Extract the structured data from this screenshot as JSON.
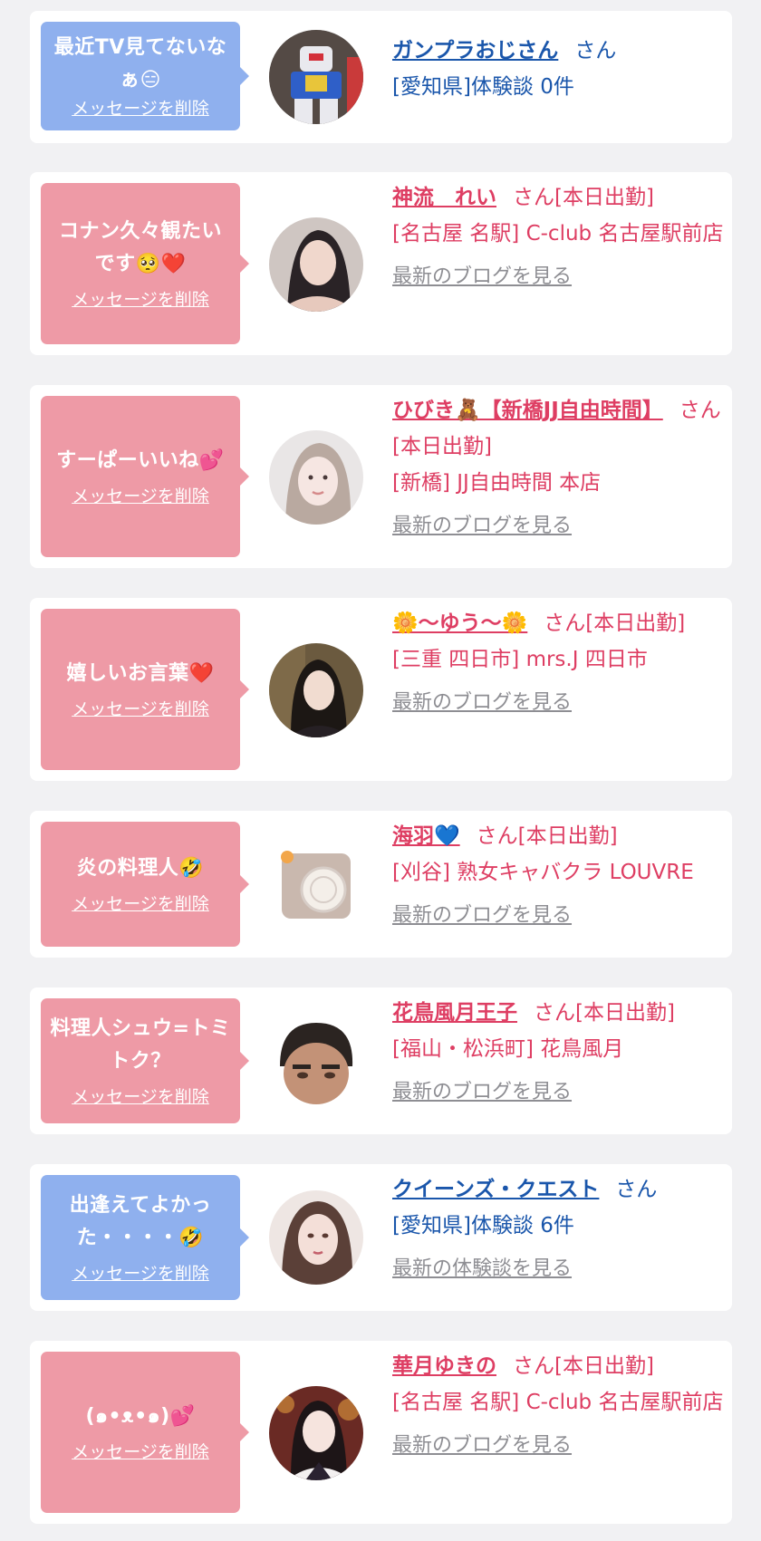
{
  "colors": {
    "pink_bubble": "#ee9aa6",
    "blue_bubble": "#8fb0ee",
    "shop_text": "#de3e63",
    "member_text": "#1a56ab",
    "link_gray": "#8e8e93"
  },
  "items": [
    {
      "bubble_color": "blue",
      "message": "最近TV見てないなぁ😑",
      "delete_label": "メッセージを削除",
      "name": "ガンプラおじさん",
      "suffix": "さん",
      "detail": "[愛知県]体験談 0件",
      "link": "",
      "avatar_icon": "robot-figure-avatar"
    },
    {
      "bubble_color": "pink",
      "message": "コナン久々観たいです🥺❤️",
      "delete_label": "メッセージを削除",
      "name": "神流　れい",
      "suffix": "さん[本日出勤]",
      "detail": "[名古屋 名駅] C-club 名古屋駅前店",
      "link": "最新のブログを見る",
      "avatar_icon": "woman-avatar"
    },
    {
      "bubble_color": "pink",
      "message": "すーぱーいいね💕",
      "delete_label": "メッセージを削除",
      "name": "ひびき🧸【新橋JJ自由時間】",
      "suffix": "さん[本日出勤]",
      "detail": "[新橋] JJ自由時間 本店",
      "link": "最新のブログを見る",
      "avatar_icon": "woman-avatar"
    },
    {
      "bubble_color": "pink",
      "message": "嬉しいお言葉❤️",
      "delete_label": "メッセージを削除",
      "name": "🌼〜ゆう〜🌼",
      "suffix": "さん[本日出勤]",
      "detail": "[三重 四日市] mrs.J 四日市",
      "link": "最新のブログを見る",
      "avatar_icon": "woman-avatar"
    },
    {
      "bubble_color": "pink",
      "message": "炎の料理人🤣",
      "delete_label": "メッセージを削除",
      "name": "海羽💙",
      "suffix": "さん[本日出勤]",
      "detail": "[刈谷] 熟女キャバクラ LOUVRE",
      "link": "最新のブログを見る",
      "avatar_icon": "lace-photo-avatar"
    },
    {
      "bubble_color": "pink",
      "message": "料理人シュウ=トミトク？",
      "delete_label": "メッセージを削除",
      "name": "花鳥風月王子",
      "suffix": "さん[本日出勤]",
      "detail": "[福山・松浜町] 花鳥風月",
      "link": "最新のブログを見る",
      "avatar_icon": "man-face-avatar"
    },
    {
      "bubble_color": "blue",
      "message": "出逢えてよかった・・・・🤣",
      "delete_label": "メッセージを削除",
      "name": "クイーンズ・クエスト",
      "suffix": "さん",
      "detail": "[愛知県]体験談 6件",
      "link": "最新の体験談を見る",
      "avatar_icon": "illustrated-woman-avatar"
    },
    {
      "bubble_color": "pink",
      "message": "(๑•ᴥ•๑)💕",
      "delete_label": "メッセージを削除",
      "name": "華月ゆきの",
      "suffix": "さん[本日出勤]",
      "detail": "[名古屋 名駅] C-club 名古屋駅前店",
      "link": "最新のブログを見る",
      "avatar_icon": "woman-avatar"
    }
  ]
}
